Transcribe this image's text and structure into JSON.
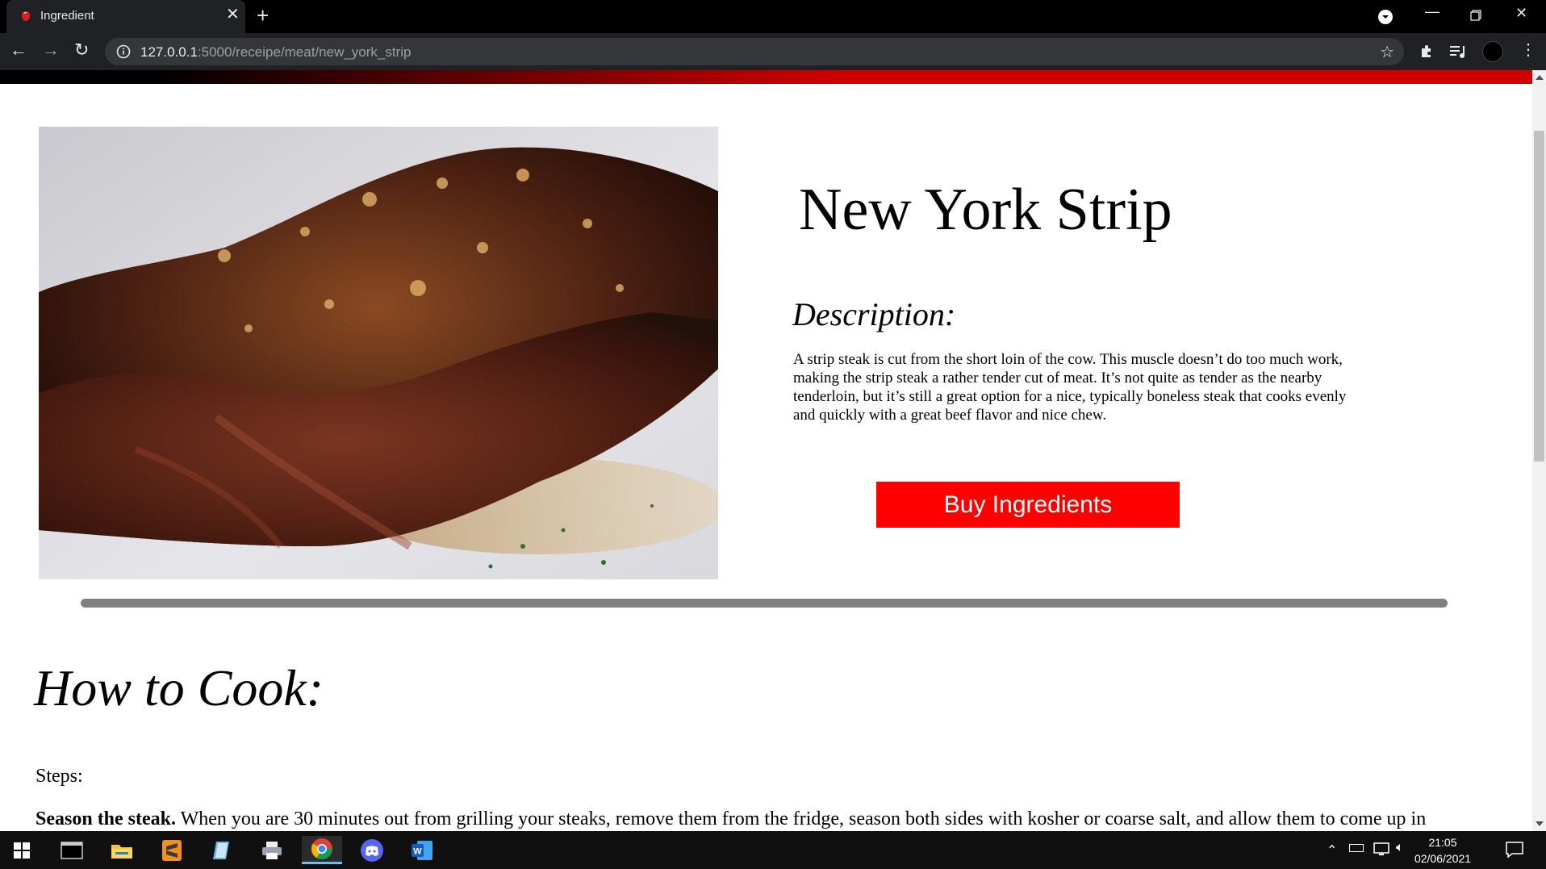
{
  "browser": {
    "tab_title": "Ingredient",
    "url_host": "127.0.0.1",
    "url_path": ":5000/receipe/meat/new_york_strip",
    "icons": [
      "favicon-icon",
      "close-icon",
      "plus-icon",
      "back-icon",
      "forward-icon",
      "reload-icon",
      "info-icon",
      "star-icon",
      "extensions-icon",
      "media-icon",
      "profile-icon",
      "menu-icon",
      "minimize-icon",
      "restore-icon",
      "window-close-icon"
    ]
  },
  "recipe": {
    "title": "New York Strip",
    "description_heading": "Description:",
    "description": "A strip steak is cut from the short loin of the cow. This muscle doesn’t do too much work, making the strip steak a rather tender cut of meat. It’s not quite as tender as the nearby tenderloin, but it’s still a great option for a nice, typically boneless steak that cooks evenly and quickly with a great beef flavor and nice chew.",
    "buy_button": "Buy Ingredients",
    "cook_heading": "How to Cook:",
    "steps_label": "Steps:",
    "step1_bold": "Season the steak.",
    "step1_text": " When you are 30 minutes out from grilling your steaks, remove them from the fridge, season both sides with kosher or coarse salt, and allow them to come up in"
  },
  "colors": {
    "accent_red": "#ff0000",
    "banner_red": "#d00000",
    "divider_gray": "#808080"
  },
  "taskbar": {
    "apps": [
      "windows-start-icon",
      "terminal-icon",
      "file-explorer-icon",
      "sublime-text-icon",
      "notepad-icon",
      "printer-icon",
      "chrome-icon",
      "discord-icon",
      "word-icon"
    ],
    "time": "21:05",
    "date": "02/06/2021"
  }
}
